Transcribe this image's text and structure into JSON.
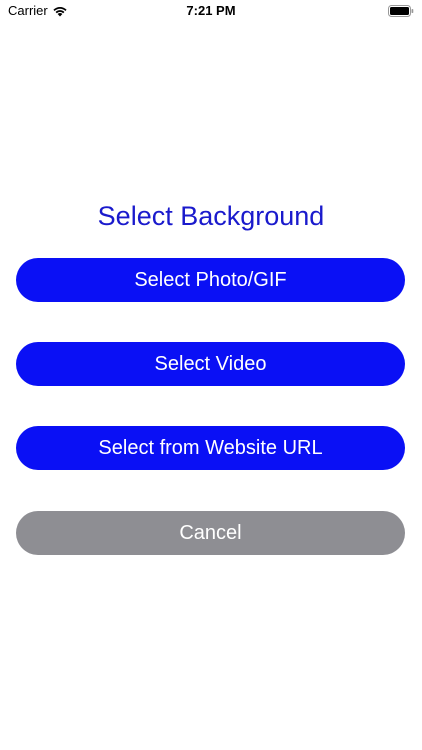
{
  "status_bar": {
    "carrier": "Carrier",
    "time": "7:21 PM",
    "wifi_icon": "wifi-icon",
    "battery_icon": "battery-icon"
  },
  "dialog": {
    "title": "Select Background",
    "buttons": [
      {
        "label": "Select Photo/GIF",
        "color": "#0a10f5"
      },
      {
        "label": "Select Video",
        "color": "#0a10f5"
      },
      {
        "label": "Select from Website URL",
        "color": "#0a10f5"
      },
      {
        "label": "Cancel",
        "color": "#8e8e93"
      }
    ]
  },
  "colors": {
    "title": "#1a1acc",
    "primary_button": "#0a10f5",
    "cancel_button": "#8e8e93",
    "background": "#ffffff"
  }
}
